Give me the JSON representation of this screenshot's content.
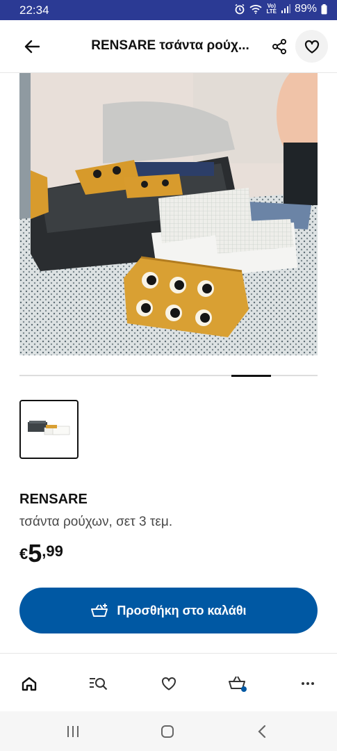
{
  "status_bar": {
    "time": "22:34",
    "volte_label": "Vo)\nLTE",
    "battery_percent": "89%",
    "icons": [
      "alarm-icon",
      "wifi-icon",
      "signal-icon",
      "battery-icon"
    ]
  },
  "header": {
    "title": "RENSARE τσάντα ρούχ...",
    "back_icon": "arrow-left-icon",
    "share_icon": "share-icon",
    "favorite_icon": "heart-icon"
  },
  "gallery": {
    "image_count_indicator": "slide-indicator",
    "thumbnail_icon": "product-thumbnail"
  },
  "product": {
    "name": "RENSARE",
    "description": "τσάντα ρούχων, σετ 3 τεμ.",
    "price_currency": "€",
    "price_integer": "5",
    "price_decimal": ",99"
  },
  "cart_button": {
    "label": "Προσθήκη στο καλάθι",
    "icon": "cart-add-icon"
  },
  "tab_bar": {
    "items": [
      {
        "name": "home",
        "icon": "home-icon"
      },
      {
        "name": "search",
        "icon": "search-list-icon"
      },
      {
        "name": "favorites",
        "icon": "heart-icon"
      },
      {
        "name": "cart",
        "icon": "cart-icon"
      },
      {
        "name": "more",
        "icon": "more-icon"
      }
    ]
  },
  "colors": {
    "status_bar": "#2b3a94",
    "cta_blue": "#0058a3",
    "cart_dot": "#0058a3",
    "text": "#111111"
  }
}
